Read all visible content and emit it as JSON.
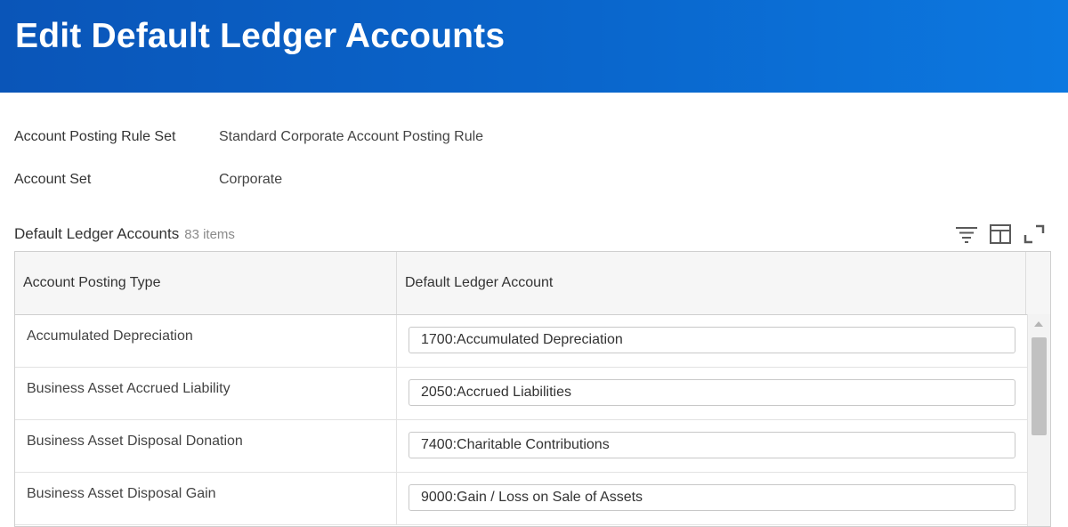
{
  "header": {
    "title": "Edit Default Ledger Accounts"
  },
  "fields": [
    {
      "label": "Account Posting Rule Set",
      "value": "Standard Corporate Account Posting Rule"
    },
    {
      "label": "Account Set",
      "value": "Corporate"
    }
  ],
  "grid": {
    "title": "Default Ledger Accounts",
    "count": "83 items",
    "columns": [
      "Account Posting Type",
      "Default Ledger Account"
    ],
    "rows": [
      {
        "type": "Accumulated Depreciation",
        "account": "1700:Accumulated Depreciation"
      },
      {
        "type": "Business Asset Accrued Liability",
        "account": "2050:Accrued Liabilities"
      },
      {
        "type": "Business Asset Disposal Donation",
        "account": "7400:Charitable Contributions"
      },
      {
        "type": "Business Asset Disposal Gain",
        "account": "9000:Gain / Loss on Sale of Assets"
      }
    ]
  },
  "toolbar": {
    "icons": [
      "filter-icon",
      "columns-icon",
      "expand-icon"
    ]
  },
  "colors": {
    "header_start": "#0a55b8",
    "header_end": "#0c78e0"
  }
}
